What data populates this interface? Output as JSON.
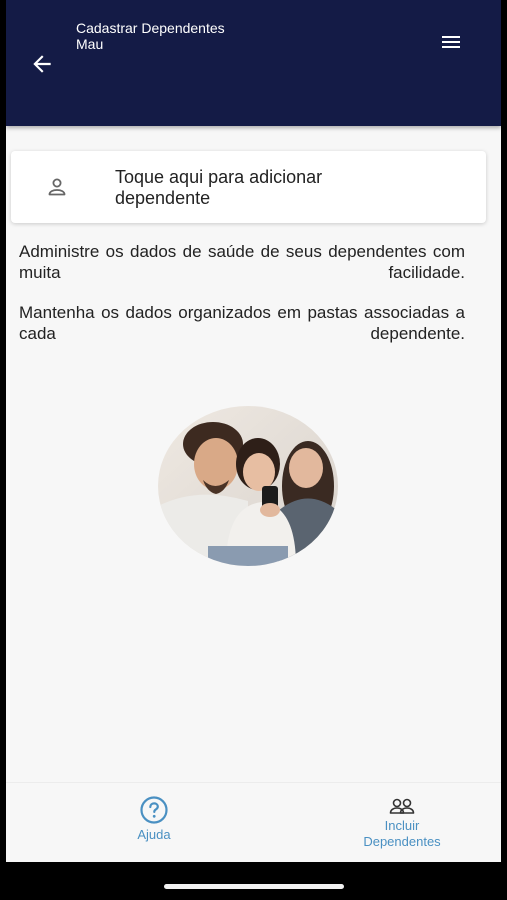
{
  "header": {
    "title": "Cadastrar Dependentes",
    "subtitle": "Mau",
    "back_icon": "arrow-left-icon",
    "menu_icon": "menu-icon",
    "background": "#141b46"
  },
  "add_card": {
    "label": "Toque aqui para adicionar dependente",
    "icon": "person-icon"
  },
  "content": {
    "paragraph_1": "Administre os dados de saúde de seus dependentes com muita facilidade.",
    "paragraph_2": "Mantenha os dados organizados em pastas associadas a cada dependente."
  },
  "bottom_nav": {
    "help_label": "Ajuda",
    "help_icon": "question-circle-icon",
    "include_label_line1": "Incluir",
    "include_label_line2": "Dependentes",
    "include_icon": "people-icon",
    "accent": "#4a90c2"
  }
}
